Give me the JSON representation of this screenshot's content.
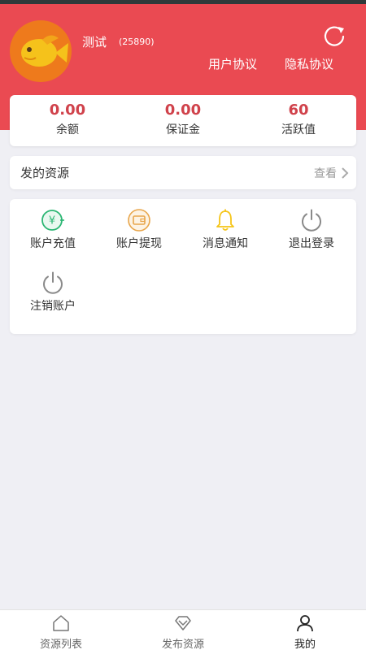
{
  "header": {
    "username": "测试",
    "user_id": "(25890)",
    "links": {
      "user_agreement": "用户协议",
      "privacy_agreement": "隐私协议"
    },
    "refresh_icon": "refresh-icon"
  },
  "stats": [
    {
      "value": "0.00",
      "label": "余额"
    },
    {
      "value": "0.00",
      "label": "保证金"
    },
    {
      "value": "60",
      "label": "活跃值"
    }
  ],
  "resources": {
    "title": "发的资源",
    "more": "查看"
  },
  "menu": [
    {
      "label": "账户充值",
      "icon": "recharge-icon"
    },
    {
      "label": "账户提现",
      "icon": "wallet-icon"
    },
    {
      "label": "消息通知",
      "icon": "bell-icon"
    },
    {
      "label": "退出登录",
      "icon": "power-icon"
    },
    {
      "label": "注销账户",
      "icon": "power-icon"
    }
  ],
  "tabbar": {
    "items": [
      {
        "label": "资源列表",
        "icon": "home-icon"
      },
      {
        "label": "发布资源",
        "icon": "diamond-icon"
      },
      {
        "label": "我的",
        "icon": "user-icon",
        "active": true
      }
    ]
  },
  "colors": {
    "header_bg": "#ea4a52",
    "stat_value": "#d0424b",
    "recharge_green": "#2bb673",
    "wallet_orange": "#e8a64c",
    "bell_yellow": "#f5c518",
    "page_bg": "#efeff4"
  }
}
